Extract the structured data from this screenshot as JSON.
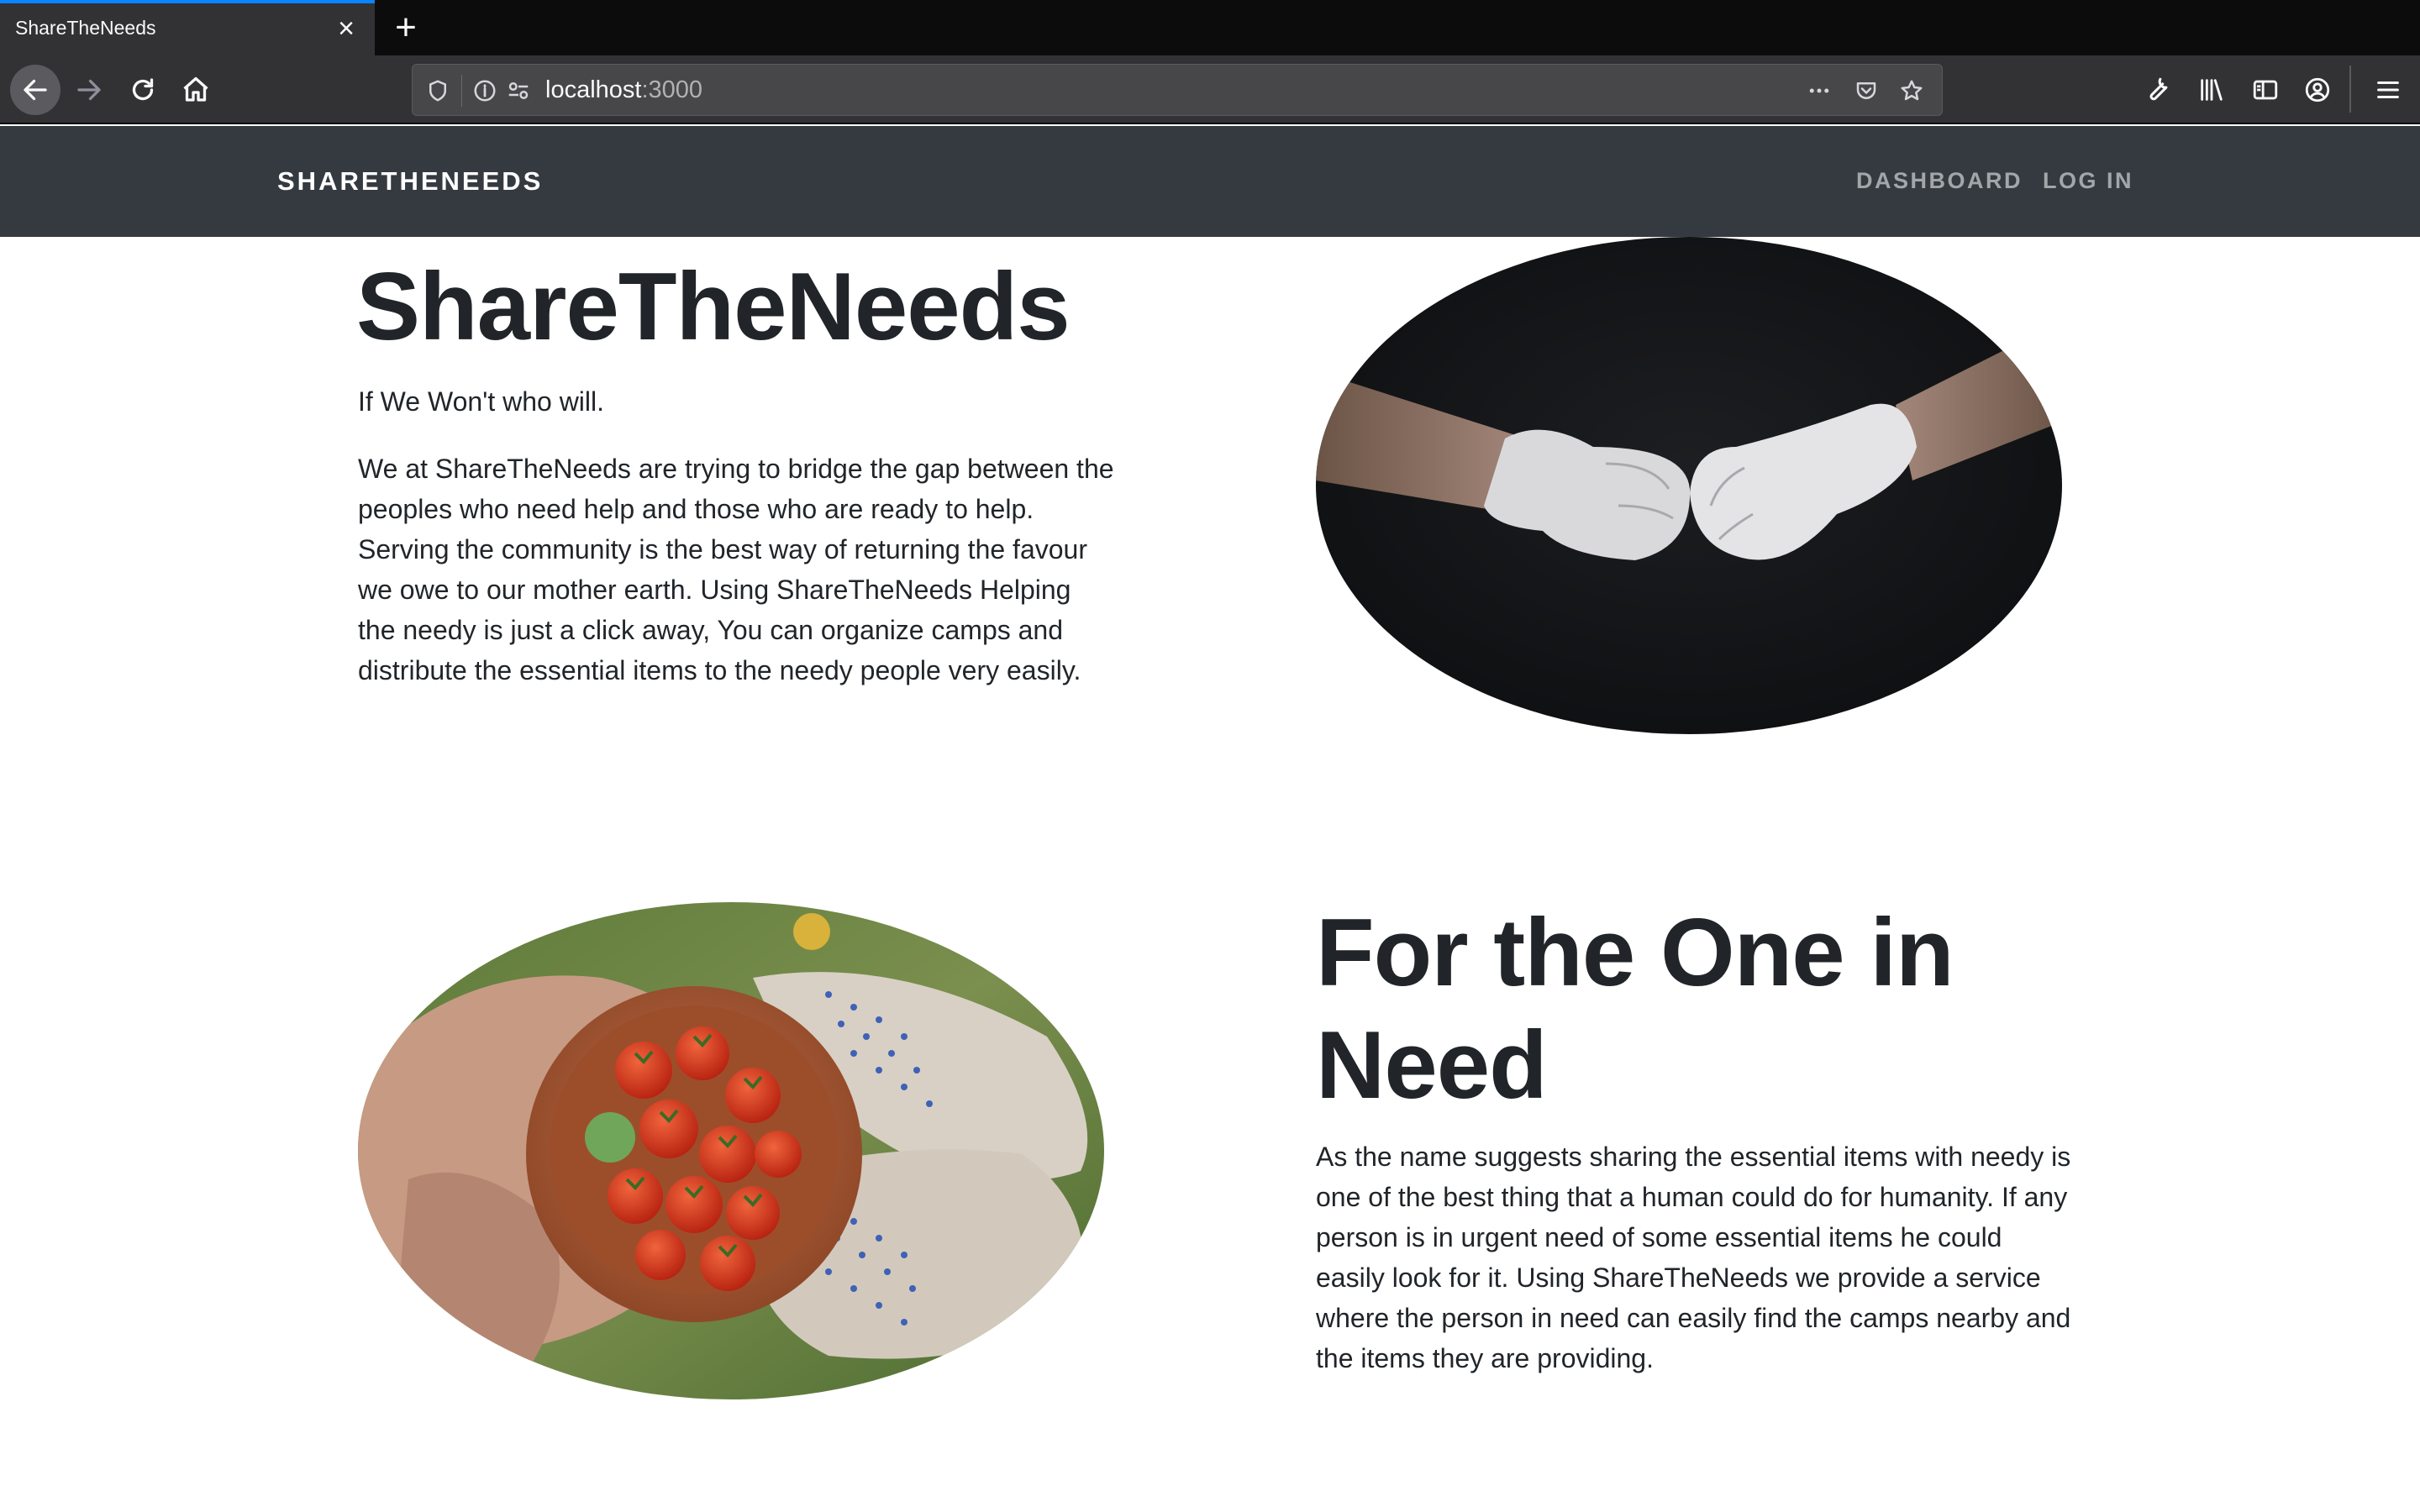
{
  "browser": {
    "tab_title": "ShareTheNeeds",
    "url_host": "localhost",
    "url_port": ":3000"
  },
  "navbar": {
    "brand": "SHARETHENEEDS",
    "links": [
      {
        "label": "DASHBOARD"
      },
      {
        "label": "LOG IN"
      }
    ]
  },
  "hero": {
    "title": "ShareTheNeeds",
    "tagline": "If We Won't who will.",
    "paragraph": "We at ShareTheNeeds are trying to bridge the gap between the peoples who need help and those who are ready to help. Serving the community is the best way of returning the favour we owe to our mother earth.  Using ShareTheNeeds Helping the needy is just a click away, You can organize camps and distribute the essential items to the needy people very easily."
  },
  "section2": {
    "title": "For the One in Need",
    "paragraph": "As the name suggests sharing the essential items with needy is one of the best thing that a human could do for humanity. If any person is in urgent need of some essential items he could easily look for it. Using ShareTheNeeds we provide a service where the person in need can easily find the camps nearby and the items they are providing."
  },
  "colors": {
    "navbar_bg": "#343a40",
    "text": "#212529",
    "tab_accent": "#0a84ff"
  }
}
